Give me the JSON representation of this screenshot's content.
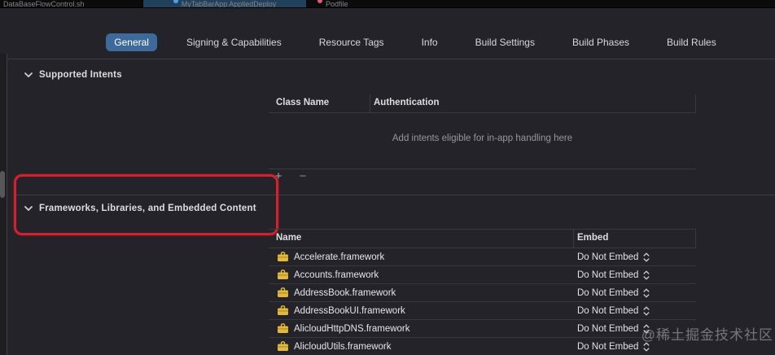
{
  "window_tabs": {
    "left": {
      "label": "DataBaseFlowControl.sh"
    },
    "active": {
      "label": "MyTabBarApp AppliedDeploy"
    },
    "right": {
      "label": "Podfile"
    }
  },
  "editor_tabs": {
    "items": [
      "General",
      "Signing & Capabilities",
      "Resource Tags",
      "Info",
      "Build Settings",
      "Build Phases",
      "Build Rules"
    ],
    "selected": "General"
  },
  "supported_intents": {
    "title": "Supported Intents",
    "columns": {
      "class_name": "Class Name",
      "authentication": "Authentication"
    },
    "placeholder": "Add intents eligible for in-app handling here",
    "add_label": "+",
    "remove_label": "−"
  },
  "frameworks": {
    "title": "Frameworks, Libraries, and Embedded Content",
    "columns": {
      "name": "Name",
      "embed": "Embed"
    },
    "rows": [
      {
        "name": "Accelerate.framework",
        "embed": "Do Not Embed"
      },
      {
        "name": "Accounts.framework",
        "embed": "Do Not Embed"
      },
      {
        "name": "AddressBook.framework",
        "embed": "Do Not Embed"
      },
      {
        "name": "AddressBookUI.framework",
        "embed": "Do Not Embed"
      },
      {
        "name": "AlicloudHttpDNS.framework",
        "embed": "Do Not Embed"
      },
      {
        "name": "AlicloudUtils.framework",
        "embed": "Do Not Embed"
      }
    ]
  },
  "watermark": "@稀土掘金技术社区",
  "colors": {
    "background": "#242329",
    "selected_tab_blue": "#3d6a9a",
    "highlight_red": "#d6202d",
    "framework_icon_yellow": "#e2b93c",
    "divider": "#3a393f"
  }
}
